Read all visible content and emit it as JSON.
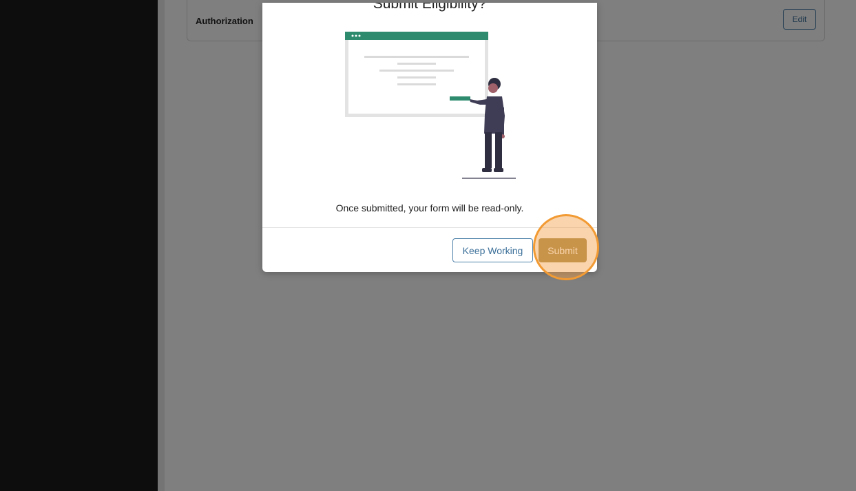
{
  "background": {
    "card": {
      "title": "Authorization",
      "edit_label": "Edit"
    }
  },
  "modal": {
    "title": "Submit Eligibility?",
    "message": "Once submitted, your form will be read-only.",
    "keep_working_label": "Keep Working",
    "submit_label": "Submit",
    "illustration_icon": "person-presenting-browser-window-illustration"
  },
  "colors": {
    "accent_green": "#2e8b6e",
    "submit_gold": "#a48b4e",
    "link_blue": "#3b6f99",
    "highlight_orange": "#f29a33"
  }
}
